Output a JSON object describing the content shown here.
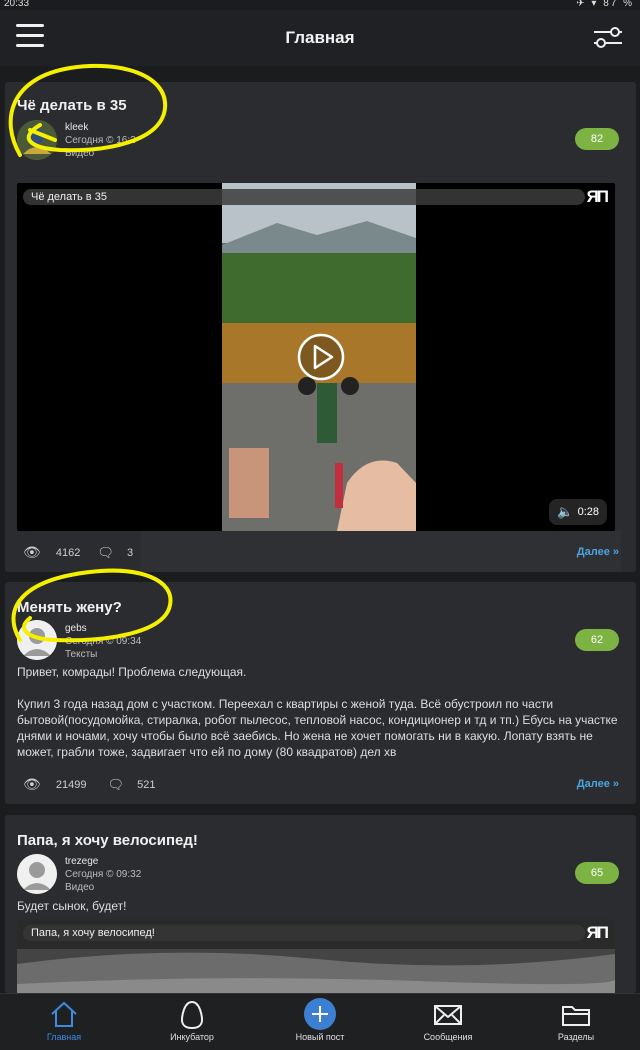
{
  "status": {
    "time": "20:33",
    "battery": "87 %"
  },
  "appbar": {
    "title": "Главная"
  },
  "posts": [
    {
      "title": "Чё делать в 35",
      "author": "kleek",
      "date": "Сегодня © 16:2",
      "type": "Видео",
      "rating": "82",
      "video": {
        "title": "Чё делать в 35",
        "duration": "0:28",
        "logo": "ЯП"
      },
      "views": "4162",
      "comments": "3",
      "more": "Далее »"
    },
    {
      "title": "Менять жену?",
      "author": "gebs",
      "date": "Сегодня © 09:34",
      "type": "Тексты",
      "rating": "62",
      "intro": "Привет, комрады! Проблема следующая.",
      "body": "Купил 3 года назад дом с участком. Переехал с квартиры с женой туда. Всё обустроил по части бытовой(посудомойка, стиралка, робот пылесос, тепловой насос, кондиционер и тд и тп.) Ебусь на участке днями и ночами, хочу чтобы было всё заебись. Но жена не хочет помогать ни в какую. Лопату взять не может, грабли тоже, задвигает что ей по дому (80 квадратов) дел хв",
      "views": "21499",
      "comments": "521",
      "more": "Далее »"
    },
    {
      "title": "Папа, я хочу велосипед!",
      "author": "trezege",
      "date": "Сегодня © 09:32",
      "type": "Видео",
      "rating": "65",
      "intro": "Будет сынок, будет!",
      "video": {
        "title": "Папа, я хочу велосипед!",
        "logo": "ЯП"
      }
    }
  ],
  "tabbar": [
    {
      "label": "Главная",
      "icon": "home-icon"
    },
    {
      "label": "Инкубатор",
      "icon": "egg-icon"
    },
    {
      "label": "Новый пост",
      "icon": "plus-icon"
    },
    {
      "label": "Сообщения",
      "icon": "envelope-icon"
    },
    {
      "label": "Разделы",
      "icon": "folder-icon"
    }
  ],
  "colors": {
    "accent": "#3d8ce0",
    "rating": "#7cb342",
    "annotation": "#f4f000"
  }
}
